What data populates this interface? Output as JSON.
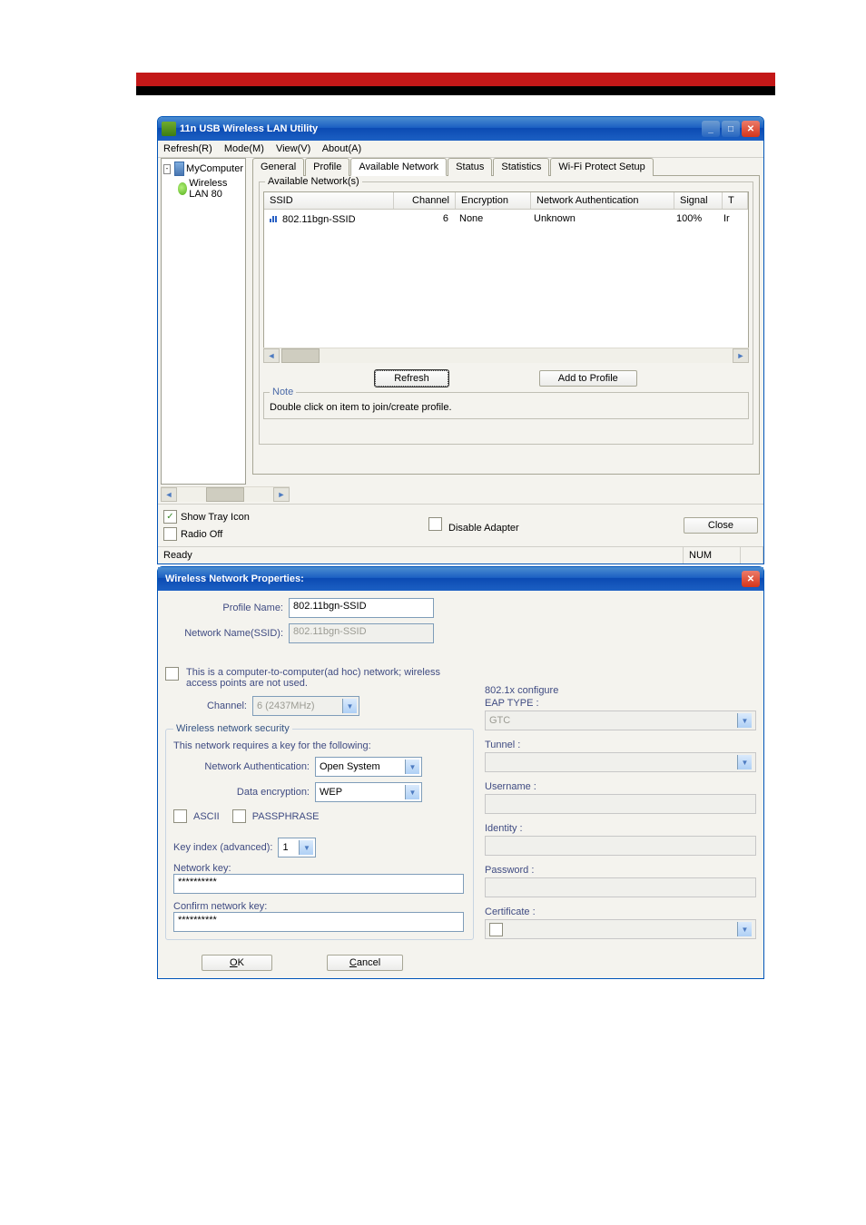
{
  "redBar": {},
  "window1": {
    "title": "11n USB Wireless LAN Utility",
    "menu": {
      "refresh": "Refresh(R)",
      "mode": "Mode(M)",
      "view": "View(V)",
      "about": "About(A)"
    },
    "tree": {
      "root": "MyComputer",
      "child": "Wireless LAN 80"
    },
    "tabs": {
      "general": "General",
      "profile": "Profile",
      "available": "Available Network",
      "status": "Status",
      "statistics": "Statistics",
      "wifi": "Wi-Fi Protect Setup"
    },
    "availableNetworks": {
      "legend": "Available Network(s)",
      "columns": {
        "ssid": "SSID",
        "channel": "Channel",
        "encryption": "Encryption",
        "netauth": "Network Authentication",
        "signal": "Signal",
        "t": "T"
      },
      "row1": {
        "ssid": "802.11bgn-SSID",
        "channel": "6",
        "encryption": "None",
        "netauth": "Unknown",
        "signal": "100%",
        "t": "Ir"
      },
      "refreshBtn": "Refresh",
      "addBtn": "Add to Profile",
      "noteLabel": "Note",
      "noteText": "Double click on item to join/create profile."
    },
    "bottom": {
      "showTray": "Show Tray Icon",
      "radioOff": "Radio Off",
      "disableAdapter": "Disable Adapter",
      "closeBtn": "Close"
    },
    "status": {
      "ready": "Ready",
      "num": "NUM"
    }
  },
  "window2": {
    "title": "Wireless Network Properties:",
    "left": {
      "profileNameLabel": "Profile Name:",
      "profileNameValue": "802.11bgn-SSID",
      "networkNameLabel": "Network Name(SSID):",
      "networkNameValue": "802.11bgn-SSID",
      "adhocText": "This is a computer-to-computer(ad hoc) network; wireless access points are not used.",
      "channelLabel": "Channel:",
      "channelValue": "6  (2437MHz)",
      "securityGroup": "Wireless network security",
      "securityText": "This network requires a key for the following:",
      "netAuthLabel": "Network Authentication:",
      "netAuthValue": "Open System",
      "dataEncLabel": "Data encryption:",
      "dataEncValue": "WEP",
      "ascii": "ASCII",
      "passphrase": "PASSPHRASE",
      "keyIndexLabel": "Key index (advanced):",
      "keyIndexValue": "1",
      "networkKeyLabel": "Network key:",
      "networkKeyValue": "**********",
      "confirmKeyLabel": "Confirm network key:",
      "confirmKeyValue": "**********",
      "okBtn": "OK",
      "cancelBtn": "Cancel"
    },
    "right": {
      "configLabel": "802.1x configure",
      "eapTypeLabel": "EAP TYPE :",
      "eapTypeValue": "GTC",
      "tunnelLabel": "Tunnel :",
      "usernameLabel": "Username :",
      "identityLabel": "Identity :",
      "passwordLabel": "Password :",
      "certificateLabel": "Certificate :"
    }
  }
}
